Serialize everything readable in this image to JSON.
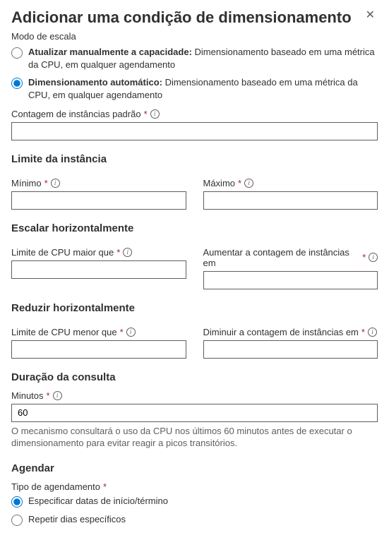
{
  "title": "Adicionar uma condição de dimensionamento",
  "scaleMode": {
    "label": "Modo de escala",
    "options": [
      {
        "bold": "Atualizar manualmente a capacidade:",
        "rest": " Dimensionamento baseado em uma métrica da CPU, em qualquer agendamento"
      },
      {
        "bold": "Dimensionamento automático:",
        "rest": " Dimensionamento baseado em uma métrica da CPU, em qualquer agendamento"
      }
    ]
  },
  "defaultCount": {
    "label": "Contagem de instâncias padrão",
    "value": ""
  },
  "instanceLimit": {
    "heading": "Limite da instância",
    "min": {
      "label": "Mínimo",
      "value": ""
    },
    "max": {
      "label": "Máximo",
      "value": ""
    }
  },
  "scaleOut": {
    "heading": "Escalar horizontalmente",
    "cpuGreater": {
      "label": "Limite de CPU maior que",
      "value": ""
    },
    "increaseBy": {
      "label": "Aumentar a contagem de instâncias em",
      "value": ""
    }
  },
  "scaleIn": {
    "heading": "Reduzir horizontalmente",
    "cpuLess": {
      "label": "Limite de CPU menor que",
      "value": ""
    },
    "decreaseBy": {
      "label": "Diminuir a contagem de instâncias em",
      "value": ""
    }
  },
  "queryDuration": {
    "heading": "Duração da consulta",
    "minutes": {
      "label": "Minutos",
      "value": "60"
    },
    "help": "O mecanismo consultará o uso da CPU nos últimos 60 minutos antes de executar o dimensionamento para evitar reagir a picos transitórios."
  },
  "schedule": {
    "heading": "Agendar",
    "typeLabel": "Tipo de agendamento",
    "options": [
      "Especificar datas de início/término",
      "Repetir dias específicos"
    ]
  }
}
